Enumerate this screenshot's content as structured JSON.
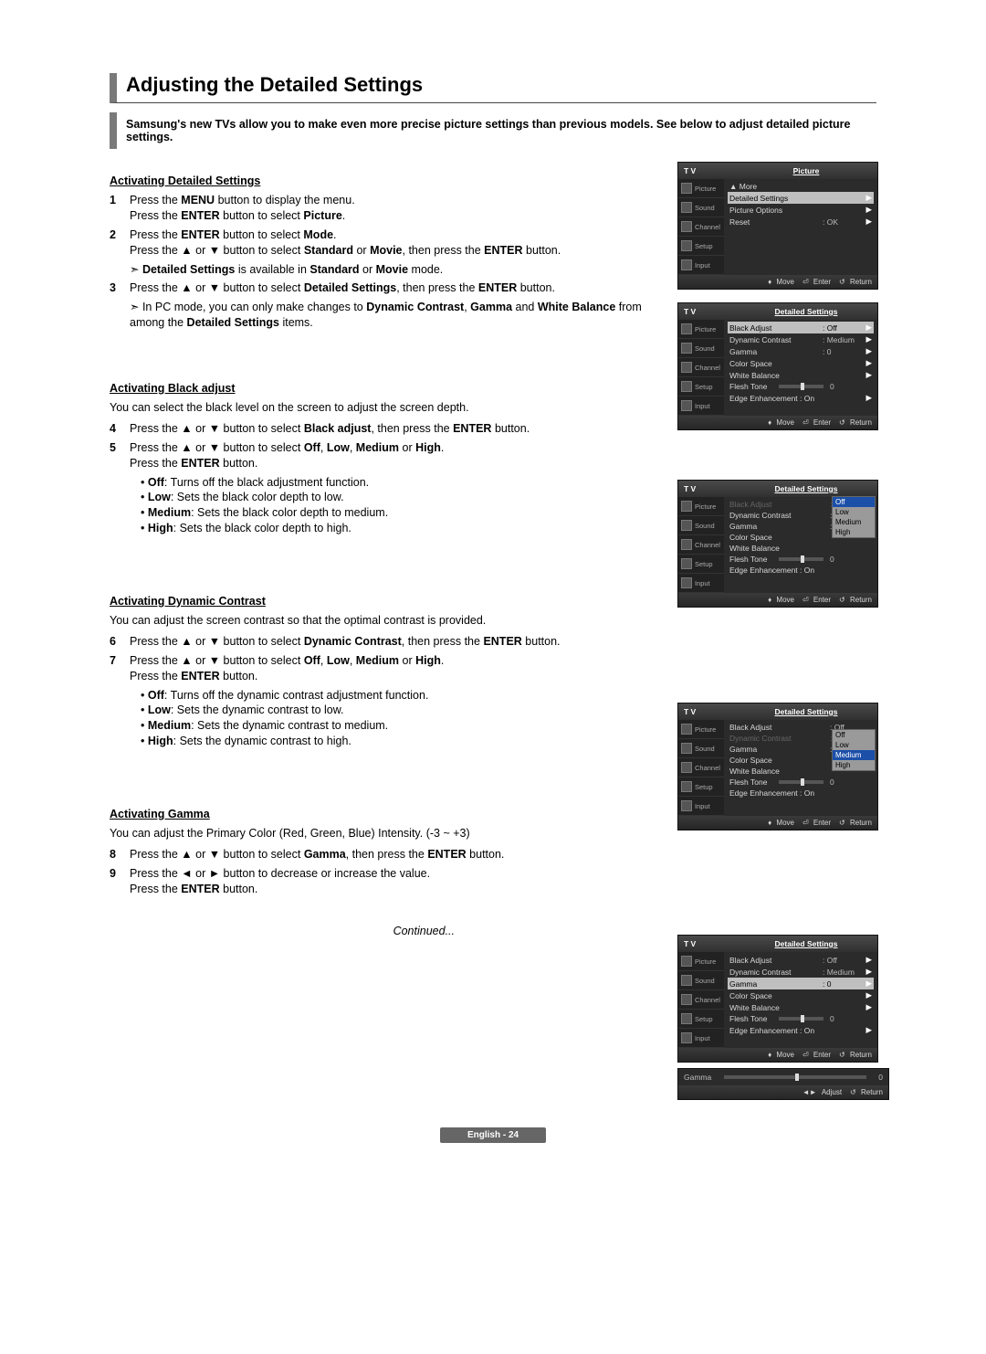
{
  "title": "Adjusting the Detailed Settings",
  "intro": "Samsung's new TVs allow you to make even more precise picture settings than previous models. See below to adjust detailed picture settings.",
  "continued": "Continued...",
  "footer": "English - 24",
  "sections": {
    "s1": {
      "head": "Activating Detailed Settings",
      "step1a": "Press the MENU button to display the menu.",
      "step1b": "Press the ENTER button to select Picture.",
      "step2a": "Press the ENTER button to select Mode.",
      "step2b": "Press the ▲ or ▼ button to select Standard or Movie, then press the ENTER button.",
      "note2": "Detailed Settings is available in Standard or Movie mode.",
      "step3": "Press the ▲ or ▼ button to select Detailed Settings, then press the ENTER button.",
      "note3": "In PC mode, you can only make changes to Dynamic Contrast, Gamma and White Balance from among the Detailed Settings items."
    },
    "s2": {
      "head": "Activating Black adjust",
      "desc": "You can select the black level on the screen to adjust the screen depth.",
      "step4": "Press the ▲ or ▼ button to select Black adjust, then press the ENTER button.",
      "step5a": "Press the ▲ or ▼ button to select Off, Low, Medium or High.",
      "step5b": "Press the ENTER button.",
      "b1": "Off: Turns off the black adjustment function.",
      "b2": "Low: Sets the black color depth to low.",
      "b3": "Medium: Sets the black color depth to medium.",
      "b4": "High: Sets the black color depth to high."
    },
    "s3": {
      "head": "Activating Dynamic Contrast",
      "desc": "You can adjust the screen contrast so that the optimal contrast is provided.",
      "step6": "Press the ▲ or ▼ button to select Dynamic Contrast, then press the ENTER button.",
      "step7a": "Press the ▲ or ▼ button to select Off, Low, Medium or High.",
      "step7b": "Press the ENTER button.",
      "b1": "Off: Turns off the dynamic contrast adjustment function.",
      "b2": "Low: Sets the dynamic contrast to low.",
      "b3": "Medium: Sets the dynamic contrast to medium.",
      "b4": "High: Sets the dynamic contrast to high."
    },
    "s4": {
      "head": "Activating Gamma",
      "desc": "You can adjust the Primary Color (Red, Green, Blue) Intensity. (-3 ~ +3)",
      "step8": "Press the ▲ or ▼ button to select Gamma, then press the ENTER button.",
      "step9a": "Press the ◄ or ► button to decrease or increase the value.",
      "step9b": "Press the ENTER button."
    }
  },
  "tv": {
    "label": "T V",
    "side": [
      "Picture",
      "Sound",
      "Channel",
      "Setup",
      "Input"
    ],
    "ftr_move": "Move",
    "ftr_enter": "Enter",
    "ftr_return": "Return",
    "ftr_adjust": "Adjust",
    "box1": {
      "title": "Picture",
      "rows": {
        "more": "▲ More",
        "ds": "Detailed Settings",
        "po": "Picture Options",
        "reset": "Reset",
        "reset_val": ": OK"
      }
    },
    "box2": {
      "title": "Detailed Settings",
      "rows": {
        "ba": "Black Adjust",
        "ba_v": ": Off",
        "dc": "Dynamic Contrast",
        "dc_v": ": Medium",
        "gm": "Gamma",
        "gm_v": ": 0",
        "cs": "Color Space",
        "wb": "White Balance",
        "ft": "Flesh Tone",
        "ft_v": "0",
        "ee": "Edge Enhancement : On"
      }
    },
    "box3_opts": {
      "o1": "Off",
      "o2": "Low",
      "o3": "Medium",
      "o4": "High"
    },
    "box5": {
      "gamma_lbl": "Gamma",
      "gamma_val": "0"
    }
  }
}
